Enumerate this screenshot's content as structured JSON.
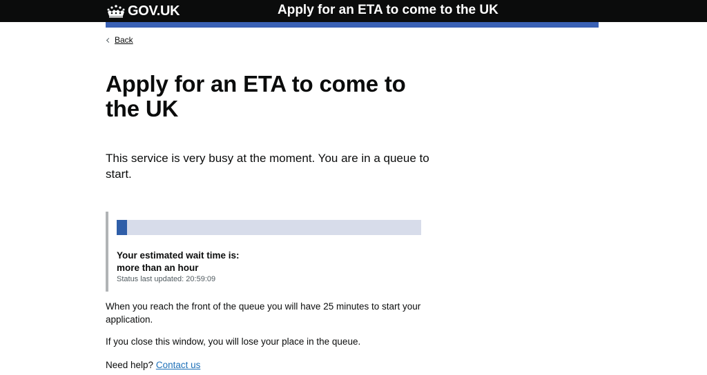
{
  "header": {
    "logo_text": "GOV.UK",
    "service_name": "Apply for an ETA to come to the UK"
  },
  "nav": {
    "back_label": "Back"
  },
  "main": {
    "title": "Apply for an ETA to come to the UK",
    "lead": "This service is very busy at the moment. You are in a queue to start.",
    "queue": {
      "progress_fraction": 0.035,
      "wait_label": "Your estimated wait time is:",
      "wait_value": "more than an hour",
      "status_prefix": "Status last updated: ",
      "status_time": "20:59:09"
    },
    "paragraphs": {
      "front_of_queue": "When you reach the front of the queue you will have 25 minutes to start your application.",
      "close_window": "If you close this window, you will lose your place in the queue.",
      "need_help": "Need help?",
      "contact_link": "Contact us"
    }
  },
  "colors": {
    "header_bg": "#0b0c0c",
    "brand_bar": "#3a61b5",
    "progress_track": "#d7dcea",
    "progress_fill": "#2f5ea8",
    "link": "#1d70b8",
    "panel_border": "#b1b4b6"
  },
  "icons": {
    "logo": "crown-icon",
    "back": "chevron-left-icon"
  }
}
